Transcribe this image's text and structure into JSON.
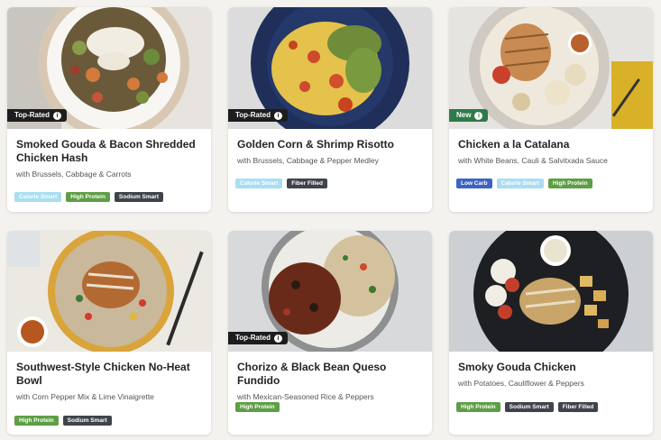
{
  "colors": {
    "page_bg": "#f3f2ee",
    "badge_dark": "#1d1d1d",
    "badge_new": "#2f7a4a",
    "tag_calorie_smart": "#a9def2",
    "tag_high_protein": "#5e9e45",
    "tag_dark": "#3f434a",
    "tag_low_carb": "#3c64c0"
  },
  "meals": [
    {
      "title": "Smoked Gouda & Bacon Shredded Chicken Hash",
      "subtitle": "with Brussels, Cabbage & Carrots",
      "badge": "Top-Rated",
      "badge_icon": "info-icon",
      "tags": [
        "Calorie Smart",
        "High Protein",
        "Sodium Smart"
      ]
    },
    {
      "title": "Golden Corn & Shrimp Risotto",
      "subtitle": "with Brussels, Cabbage & Pepper Medley",
      "badge": "Top-Rated",
      "badge_icon": "info-icon",
      "tags": [
        "Calorie Smart",
        "Fiber Filled"
      ]
    },
    {
      "title": "Chicken a la Catalana",
      "subtitle": "with White Beans, Cauli & Salvitxada Sauce",
      "badge": "New",
      "badge_icon": "info-icon",
      "tags": [
        "Low Carb",
        "Calorie Smart",
        "High Protein"
      ]
    },
    {
      "title": "Southwest-Style Chicken No-Heat Bowl",
      "subtitle": "with Corn Pepper Mix & Lime Vinaigrette",
      "badge": "",
      "tags": [
        "High Protein",
        "Sodium Smart"
      ]
    },
    {
      "title": "Chorizo & Black Bean Queso Fundido",
      "subtitle": "with Mexican-Seasoned Rice & Peppers",
      "badge": "Top-Rated",
      "badge_icon": "info-icon",
      "tags": [
        "High Protein"
      ]
    },
    {
      "title": "Smoky Gouda Chicken",
      "subtitle": "with Potatoes, Cauliflower & Peppers",
      "badge": "",
      "tags": [
        "High Protein",
        "Sodium Smart",
        "Fiber Filled"
      ]
    }
  ]
}
